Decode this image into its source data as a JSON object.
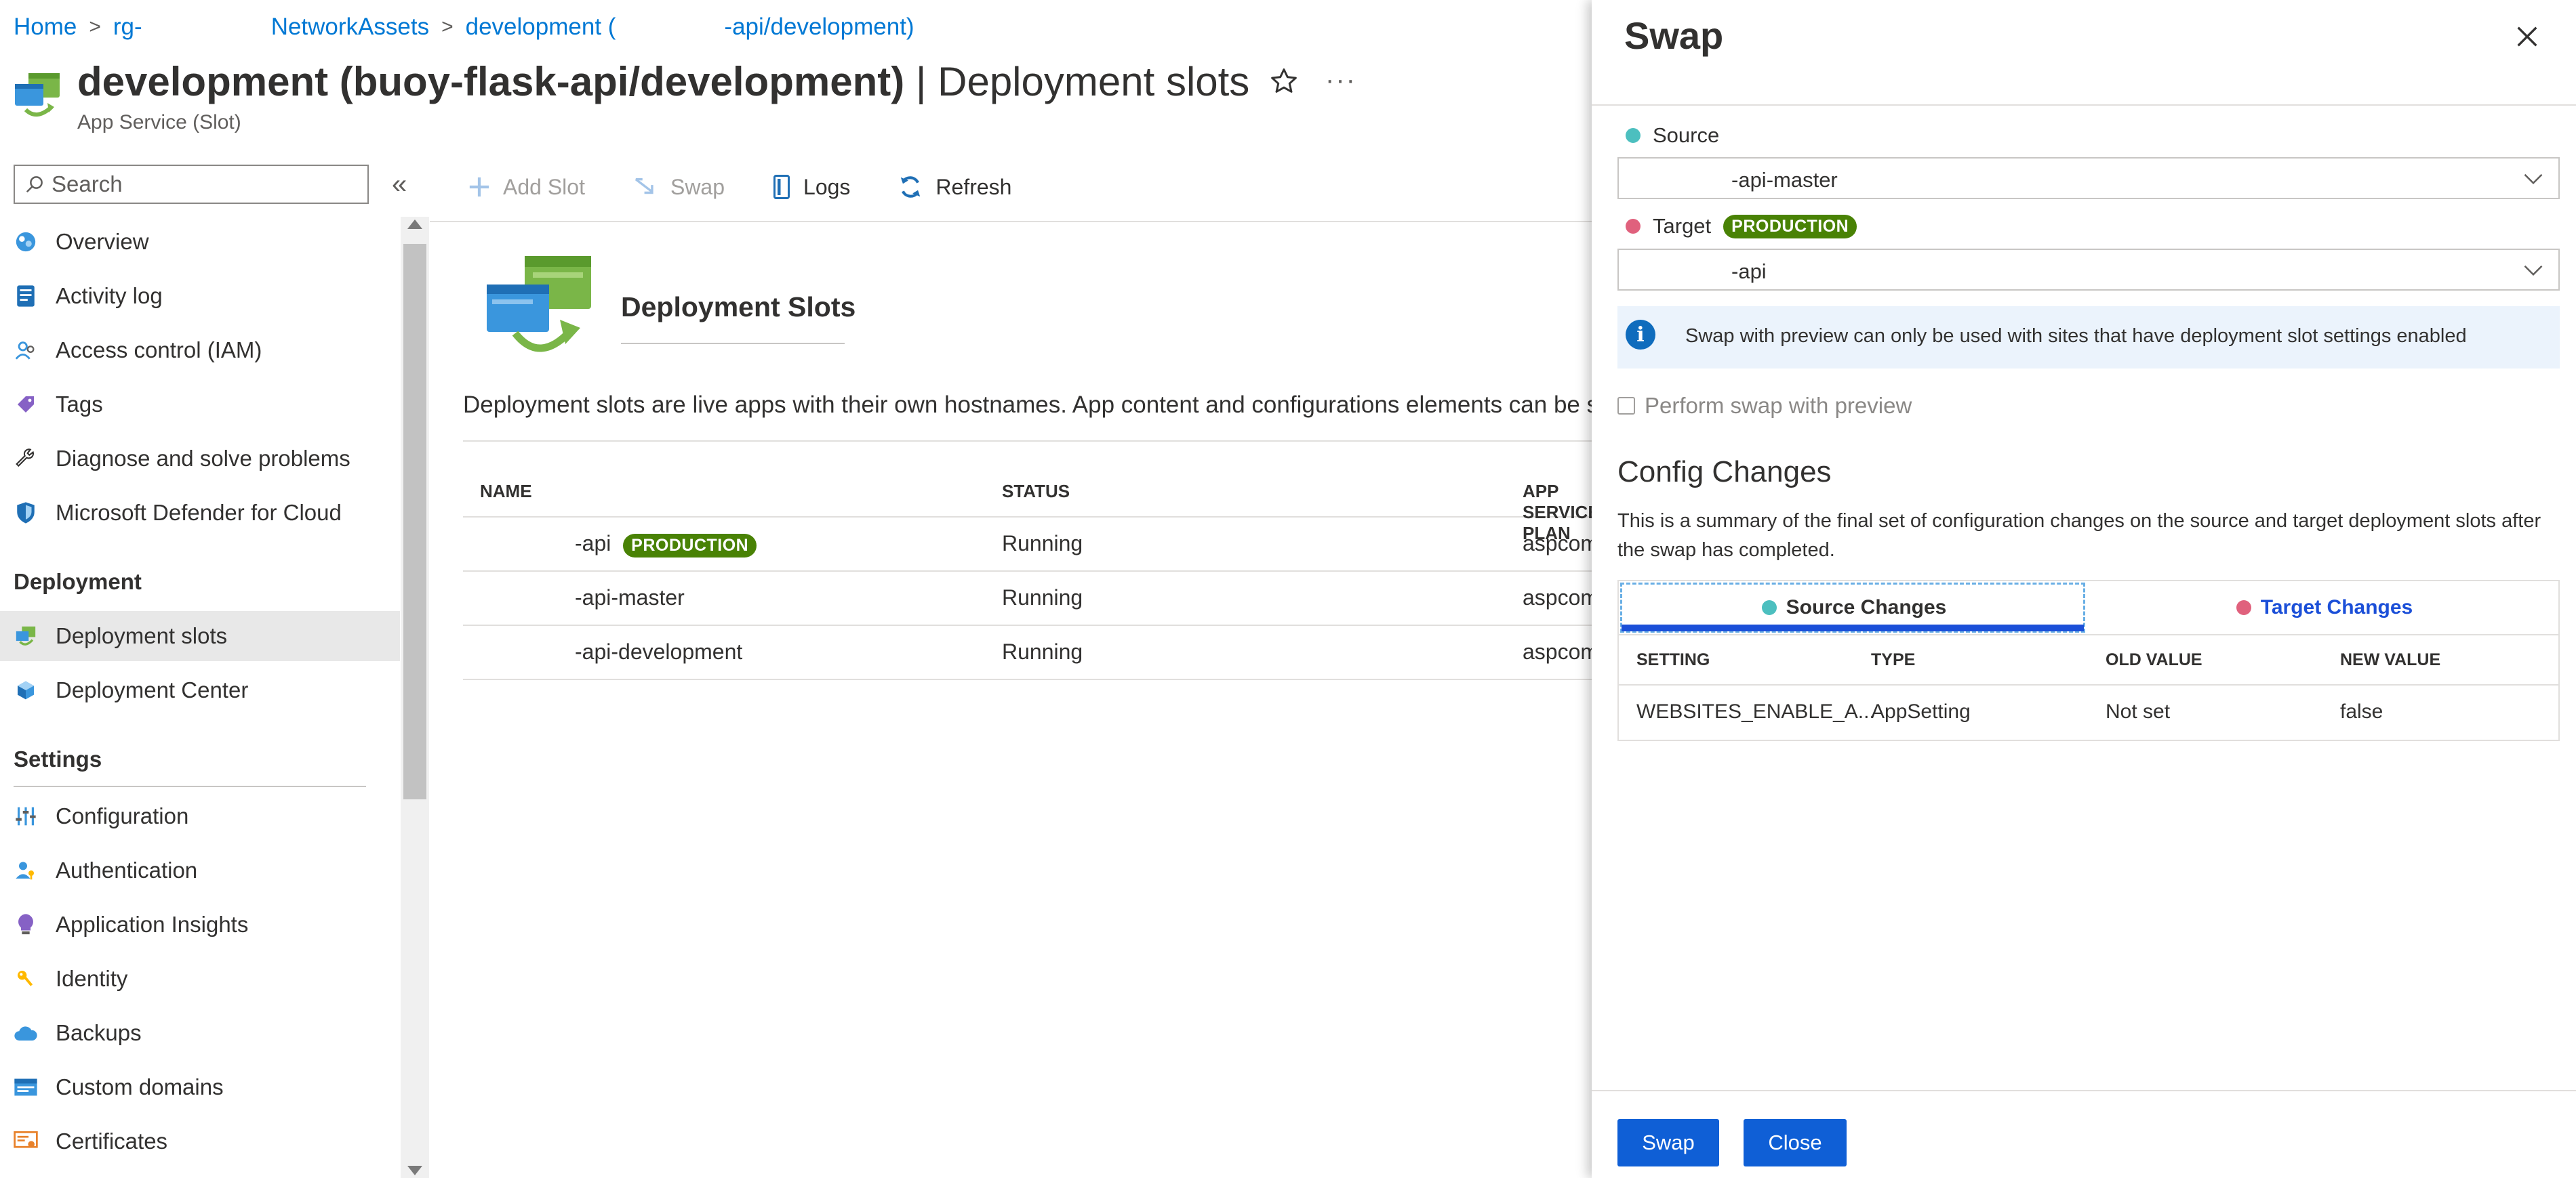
{
  "breadcrumb": {
    "home": "Home",
    "rg": "rg-",
    "network_assets": "NetworkAssets",
    "dev_prefix": "development (",
    "dev_suffix": "-api/development)"
  },
  "header": {
    "title_bold": "development (buoy-flask-api/development)",
    "title_rest": " | Deployment slots",
    "subtitle": "App Service (Slot)"
  },
  "search": {
    "placeholder": "Search"
  },
  "sidebar": {
    "items": [
      {
        "label": "Overview",
        "icon": "overview-icon"
      },
      {
        "label": "Activity log",
        "icon": "activity-log-icon"
      },
      {
        "label": "Access control (IAM)",
        "icon": "iam-icon"
      },
      {
        "label": "Tags",
        "icon": "tag-icon"
      },
      {
        "label": "Diagnose and solve problems",
        "icon": "wrench-icon"
      },
      {
        "label": "Microsoft Defender for Cloud",
        "icon": "shield-icon"
      }
    ],
    "deployment_section": "Deployment",
    "deployment_items": [
      {
        "label": "Deployment slots",
        "icon": "deployment-slots-icon",
        "active": true
      },
      {
        "label": "Deployment Center",
        "icon": "cube-icon"
      }
    ],
    "settings_section": "Settings",
    "settings_items": [
      {
        "label": "Configuration",
        "icon": "sliders-icon"
      },
      {
        "label": "Authentication",
        "icon": "person-key-icon"
      },
      {
        "label": "Application Insights",
        "icon": "lightbulb-icon"
      },
      {
        "label": "Identity",
        "icon": "key-icon"
      },
      {
        "label": "Backups",
        "icon": "cloud-icon"
      },
      {
        "label": "Custom domains",
        "icon": "domain-icon"
      },
      {
        "label": "Certificates",
        "icon": "certificate-icon"
      }
    ]
  },
  "toolbar": {
    "add_slot": "Add Slot",
    "swap": "Swap",
    "logs": "Logs",
    "refresh": "Refresh"
  },
  "content": {
    "heading": "Deployment Slots",
    "description": "Deployment slots are live apps with their own hostnames. App content and configurations elements can be swapped between two deployment slots, including the production slot.",
    "columns": [
      "NAME",
      "STATUS",
      "APP SERVICE PLAN"
    ],
    "rows": [
      {
        "name": "-api",
        "badge": "PRODUCTION",
        "status": "Running",
        "plan": "aspcom"
      },
      {
        "name": "-api-master",
        "badge": "",
        "status": "Running",
        "plan": "aspcom"
      },
      {
        "name": "-api-development",
        "badge": "",
        "status": "Running",
        "plan": "aspcom"
      }
    ]
  },
  "panel": {
    "title": "Swap",
    "source_label": "Source",
    "source_value": "-api-master",
    "target_label": "Target",
    "target_badge": "PRODUCTION",
    "target_value": "-api",
    "info_text": "Swap with preview can only be used with sites that have deployment slot settings enabled",
    "preview_label": "Perform swap with preview",
    "config_title": "Config Changes",
    "config_desc": "This is a summary of the final set of configuration changes on the source and target deployment slots after the swap has completed.",
    "tab_source": "Source Changes",
    "tab_target": "Target Changes",
    "changes_columns": [
      "SETTING",
      "TYPE",
      "OLD VALUE",
      "NEW VALUE"
    ],
    "changes_rows": [
      {
        "setting": "WEBSITES_ENABLE_A...",
        "type": "AppSetting",
        "old": "Not set",
        "new": "false"
      }
    ],
    "swap_button": "Swap",
    "close_button": "Close"
  },
  "colors": {
    "accent": "#0078d4",
    "source_dot": "#4cbfbf",
    "target_dot": "#e0617d",
    "production_badge": "#498205",
    "primary_button": "#0f5fd6"
  }
}
